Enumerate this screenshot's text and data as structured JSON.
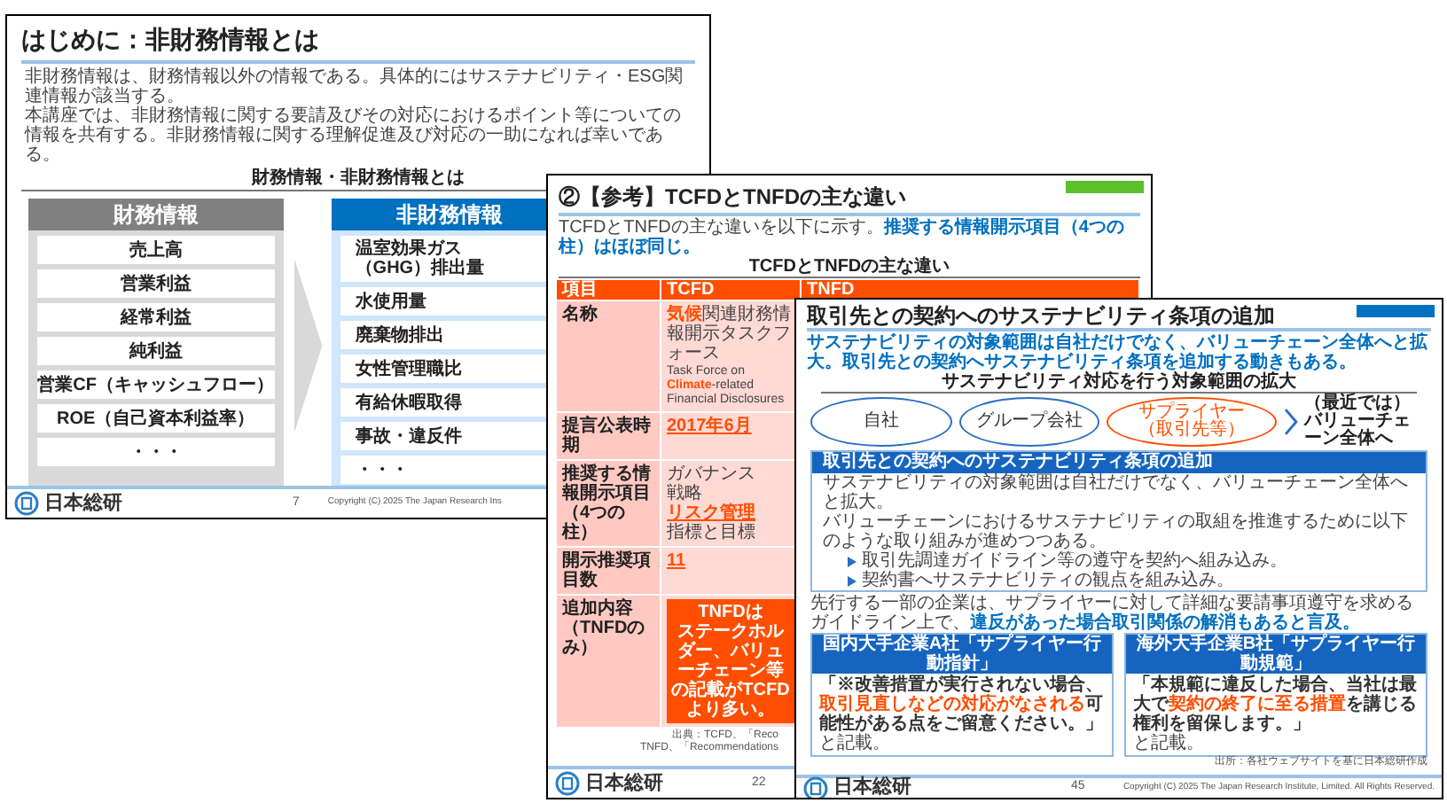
{
  "slides": [
    {
      "kind": "intro",
      "title": "はじめに：非財務情報とは",
      "body": [
        "非財務情報は、財務情報以外の情報である。具体的にはサステナビリティ・ESG関連情報が該当する。",
        "本講座では、非財務情報に関する要請及びその対応におけるポイント等についての情報を共有する。非財務情報に関する理解促進及び対応の一助になれば幸いである。"
      ],
      "diagram_title": "財務情報・非財務情報とは",
      "left": {
        "header": "財務情報",
        "items": [
          "売上高",
          "営業利益",
          "経常利益",
          "純利益",
          "営業CF（キャッシュフロー）",
          "ROE（自己資本利益率）",
          "・・・"
        ]
      },
      "right": {
        "header": "非財務情報",
        "items": [
          "温室効果ガス（GHG）排出量",
          "水使用量",
          "廃棄物排出",
          "女性管理職比",
          "有給休暇取得",
          "事故・違反件",
          "・・・"
        ]
      },
      "logo": "日本総研",
      "page": "7",
      "copyright": "Copyright (C) 2025 The Japan Research Ins"
    },
    {
      "kind": "comparison",
      "title": "②【参考】TCFDとTNFDの主な違い",
      "intro": "TCFDとTNFDの主な違いを以下に示す。",
      "highlight": "推奨する情報開示項目（4つの柱）はほぼ同じ。",
      "table_title": "TCFDとTNFDの主な違い",
      "columns": [
        "項目",
        "TCFD",
        "TNFD"
      ],
      "rows": [
        {
          "label": "名称",
          "cells": [
            {
              "lines": [
                {
                  "kind": "text",
                  "text": "**気候**関連財務情報開示タスクフォース"
                },
                {
                  "kind": "english",
                  "text": "Task Force on **Climate**-related Financial Disclosures"
                }
              ]
            }
          ]
        },
        {
          "label": "提言公表時期",
          "cells": [
            {
              "lines": [
                {
                  "kind": "highlight",
                  "text": "2017年6月"
                }
              ]
            }
          ]
        },
        {
          "label": "推奨する情報開示項目（4つの柱）",
          "cells": [
            {
              "lines": [
                {
                  "kind": "text",
                  "text": "ガバナンス"
                },
                {
                  "kind": "text",
                  "text": "戦略"
                },
                {
                  "kind": "highlight",
                  "text": "リスク管理"
                },
                {
                  "kind": "text",
                  "text": "指標と目標"
                }
              ]
            }
          ]
        },
        {
          "label": "開示推奨項目数",
          "cells": [
            {
              "lines": [
                {
                  "kind": "highlight",
                  "text": "11"
                }
              ]
            }
          ]
        },
        {
          "label": "追加内容（TNFDのみ）",
          "cells": [
            {
              "callout": [
                "TNFDは",
                "ステークホルダー、バリューチェーン等の記載がTCFDより多い。"
              ]
            }
          ]
        }
      ],
      "sources": [
        "出典：TCFD、「Reco",
        "TNFD、「Recommendations"
      ],
      "logo": "日本総研",
      "page": "22"
    },
    {
      "kind": "contract",
      "title": "取引先との契約へのサステナビリティ条項の追加",
      "lead": "サステナビリティの対象範囲は自社だけでなく、バリューチェーン全体へと拡大。取引先との契約へサステナビリティ条項を追加する動きもある。",
      "diagram_title": "サステナビリティ対応を行う対象範囲の拡大",
      "scopes": [
        {
          "label": "自社",
          "highlight": false
        },
        {
          "label": "グループ会社",
          "highlight": false
        },
        {
          "label": "サプライヤー（取引先等）",
          "highlight": true
        }
      ],
      "scope_note": "（最近では）バリューチェーン全体へ",
      "section_header": "取引先との契約へのサステナビリティ条項の追加",
      "section_body": [
        "サステナビリティの対象範囲は自社だけでなく、バリューチェーン全体へと拡大。",
        "バリューチェーンにおけるサステナビリティの取組を推進するために以下のような取り組みが進めつつある。"
      ],
      "bullets": [
        "取引先調達ガイドライン等の遵守を契約へ組み込み。",
        "契約書へサステナビリティの観点を組み込み。"
      ],
      "note": "先行する一部の企業は、サプライヤーに対して詳細な要請事項遵守を求めるガイドライン上で、",
      "note_highlight": "違反があった場合取引関係の解消もあると言及。",
      "examples": [
        {
          "header": "国内大手企業A社「サプライヤー行動指針」",
          "quote": "「※改善措置が実行されない場合、**取引見直しなどの対応がなされる**可能性がある点をご留意ください。」",
          "after": "と記載。"
        },
        {
          "header": "海外大手企業B社「サプライヤー行動規範」",
          "quote": "「本規範に違反した場合、当社は最大で**契約の終了に至る措置**を講じる権利を留保します。」",
          "after": "と記載。"
        }
      ],
      "source": "出所：各社ウェブサイトを基に日本総研作成",
      "logo": "日本総研",
      "page": "45",
      "copyright": "Copyright (C) 2025 The Japan Research Institute, Limited. All Rights Reserved."
    }
  ]
}
